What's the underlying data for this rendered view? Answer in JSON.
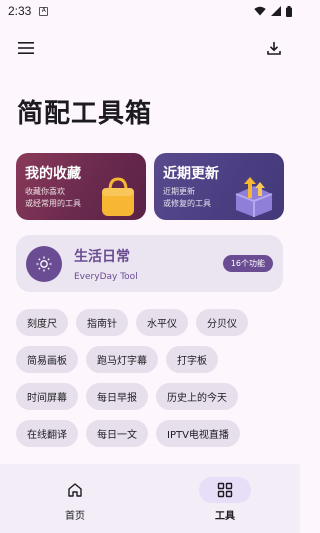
{
  "status_bar": {
    "time": "2:33"
  },
  "page": {
    "title": "简配工具箱"
  },
  "cards": {
    "favorites": {
      "title": "我的收藏",
      "sub1": "收藏你喜欢",
      "sub2": "或经常用的工具"
    },
    "recent": {
      "title": "近期更新",
      "sub1": "近期更新",
      "sub2": "或修复的工具"
    }
  },
  "feature": {
    "title": "生活日常",
    "subtitle": "EveryDay Tool",
    "count": "16个功能"
  },
  "chips": [
    [
      "刻度尺",
      "指南针",
      "水平仪",
      "分贝仪"
    ],
    [
      "简易画板",
      "跑马灯字幕",
      "打字板"
    ],
    [
      "时间屏幕",
      "每日早报",
      "历史上的今天"
    ],
    [
      "在线翻译",
      "每日一文",
      "IPTV电视直播"
    ]
  ],
  "nav": {
    "home": "首页",
    "tools": "工具"
  },
  "colors": {
    "accent": "#6a4c93",
    "fav_card": "#7a3355",
    "recent_card": "#4b3f82"
  }
}
